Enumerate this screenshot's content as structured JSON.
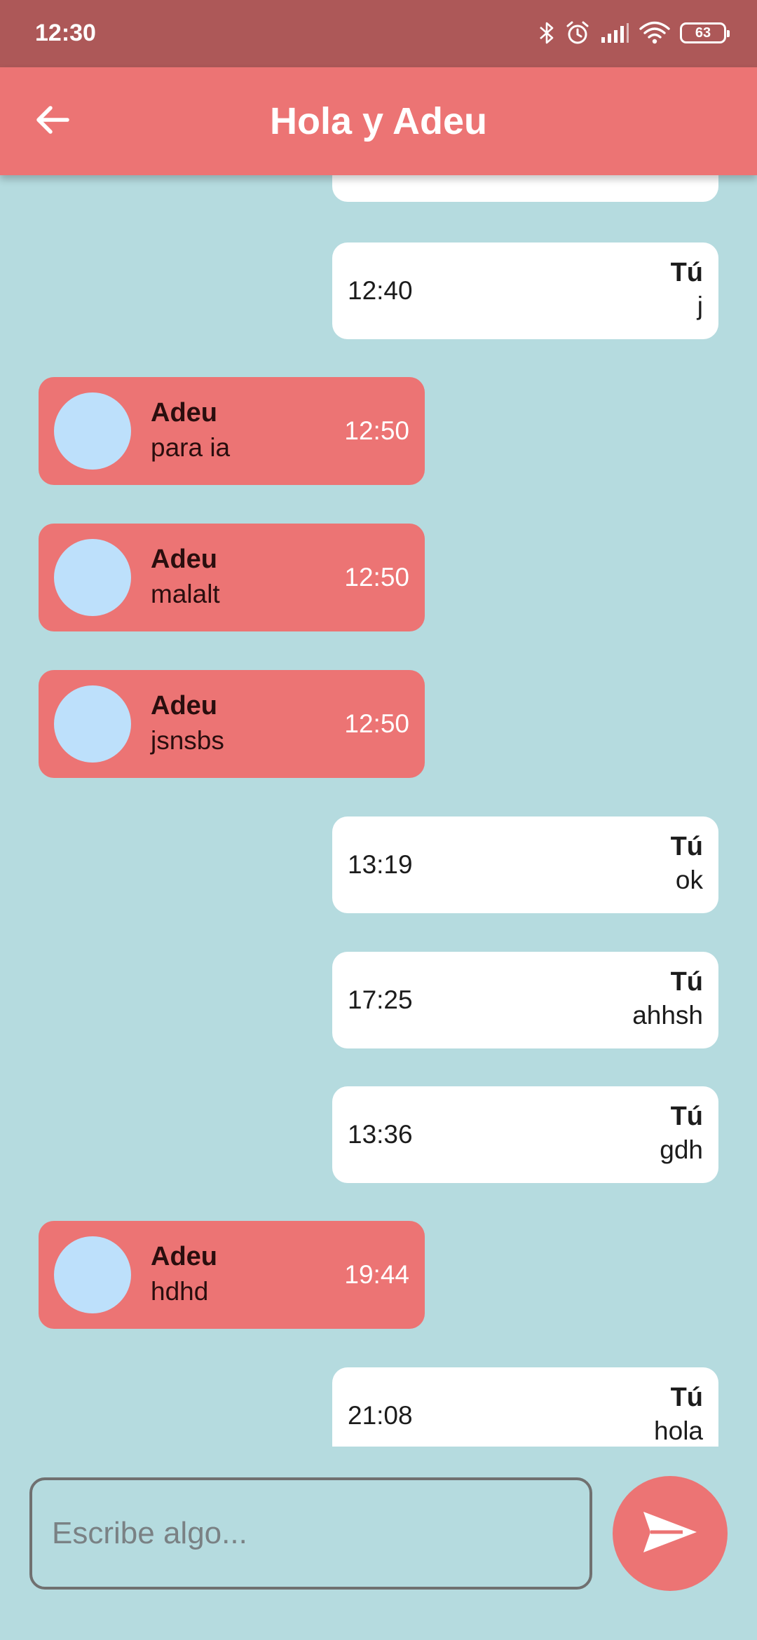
{
  "status_bar": {
    "time": "12:30",
    "battery_level": "63",
    "icons": [
      "bluetooth-icon",
      "alarm-icon",
      "signal-icon",
      "wifi-icon",
      "battery-icon"
    ]
  },
  "app_bar": {
    "title": "Hola y Adeu",
    "back_icon": "arrow-left-icon"
  },
  "messages": [
    {
      "direction": "out",
      "sender": "",
      "text": ".",
      "time": ""
    },
    {
      "direction": "out",
      "sender": "Tú",
      "text": "j",
      "time": "12:40"
    },
    {
      "direction": "in",
      "sender": "Adeu",
      "text": "para ia",
      "time": "12:50"
    },
    {
      "direction": "in",
      "sender": "Adeu",
      "text": "malalt",
      "time": "12:50"
    },
    {
      "direction": "in",
      "sender": "Adeu",
      "text": "jsnsbs",
      "time": "12:50"
    },
    {
      "direction": "out",
      "sender": "Tú",
      "text": "ok",
      "time": "13:19"
    },
    {
      "direction": "out",
      "sender": "Tú",
      "text": "ahhsh",
      "time": "17:25"
    },
    {
      "direction": "out",
      "sender": "Tú",
      "text": "gdh",
      "time": "13:36"
    },
    {
      "direction": "in",
      "sender": "Adeu",
      "text": "hdhd",
      "time": "19:44"
    },
    {
      "direction": "out",
      "sender": "Tú",
      "text": "hola",
      "time": "21:08"
    }
  ],
  "composer": {
    "placeholder": "Escribe algo...",
    "value": "",
    "send_icon": "send-icon"
  },
  "colors": {
    "status_bar": "#ad5858",
    "app_bar": "#ec7474",
    "background": "#b5dbdf",
    "incoming_bubble": "#ec7474",
    "outgoing_bubble": "#ffffff",
    "avatar": "#bde0fb"
  }
}
